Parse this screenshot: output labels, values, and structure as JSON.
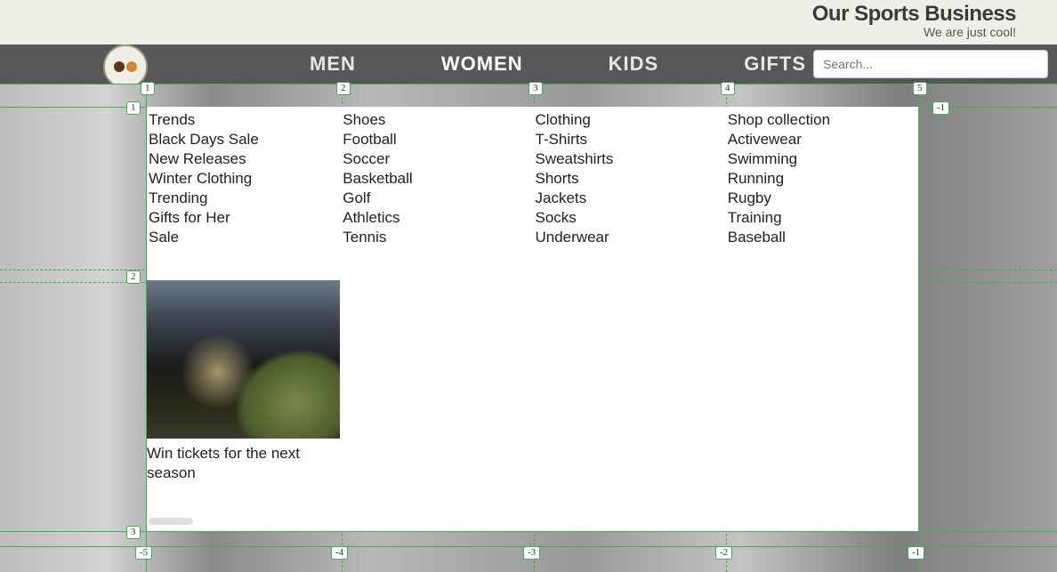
{
  "header": {
    "brand_name": "Our Sports Business",
    "brand_tagline": "We are just cool!"
  },
  "nav": {
    "items": [
      "MEN",
      "WOMEN",
      "KIDS",
      "GIFTS"
    ],
    "active_index": 1
  },
  "search": {
    "placeholder": "Search..."
  },
  "mega_menu": {
    "columns": [
      {
        "heading": "Trends",
        "links": [
          "Black Days Sale",
          "New Releases",
          "Winter Clothing",
          "Trending",
          "Gifts for Her",
          "Sale"
        ]
      },
      {
        "heading": "Shoes",
        "links": [
          "Football",
          "Soccer",
          "Basketball",
          "Golf",
          "Athletics",
          "Tennis"
        ]
      },
      {
        "heading": "Clothing",
        "links": [
          "T-Shirts",
          "Sweatshirts",
          "Shorts",
          "Jackets",
          "Socks",
          "Underwear"
        ]
      },
      {
        "heading": "Shop collection",
        "links": [
          "Activewear",
          "Swimming",
          "Running",
          "Rugby",
          "Training",
          "Baseball"
        ]
      }
    ],
    "promo": {
      "caption": "Win tickets for the next season"
    }
  },
  "grid_markers": {
    "cols_top": [
      "1",
      "2",
      "3",
      "4",
      "5"
    ],
    "cols_bottom": [
      "-5",
      "-4",
      "-3",
      "-2",
      "-1"
    ],
    "rows_left": [
      "1",
      "2",
      "3"
    ],
    "rows_right": [
      "-1"
    ]
  }
}
